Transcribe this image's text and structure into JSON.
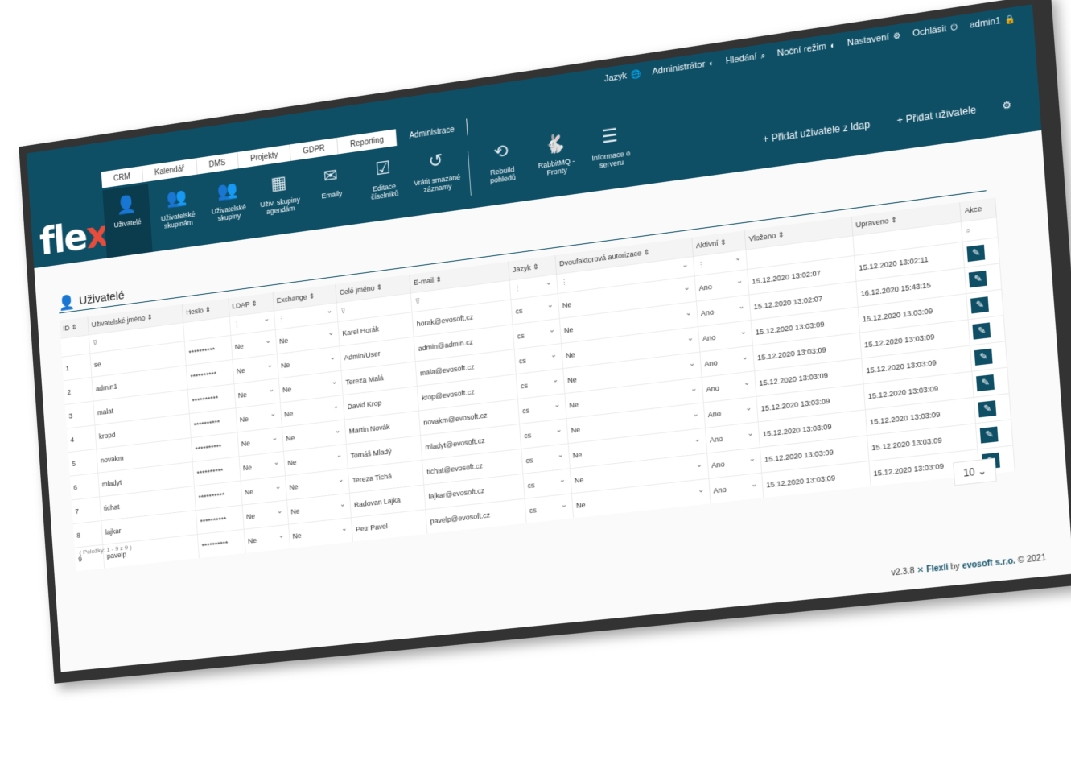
{
  "header": {
    "utility": [
      {
        "label": "Jazyk",
        "icon": "globe-icon"
      },
      {
        "label": "Administrátor",
        "icon": "toggle-icon"
      },
      {
        "label": "Hledání",
        "icon": "search-icon"
      },
      {
        "label": "Noční režim",
        "icon": "toggle-icon"
      },
      {
        "label": "Nastavení",
        "icon": "gear-icon"
      },
      {
        "label": "Ochlásit",
        "icon": "power-icon"
      },
      {
        "label": "admin1",
        "icon": "user-lock-icon"
      }
    ],
    "logo": "flexii",
    "tabs": [
      "CRM",
      "Kalendář",
      "DMS",
      "Projekty",
      "GDPR",
      "Reporting",
      "Administrace"
    ],
    "active_tab": "Administrace",
    "subnav": [
      {
        "label": "Uživatelé",
        "icon": "user-gear-icon",
        "active": true
      },
      {
        "label": "Uživatelské skupinám",
        "icon": "users-gear-icon"
      },
      {
        "label": "Uživatelské skupiny",
        "icon": "users-icon"
      },
      {
        "label": "Uživ. skupiny agendám",
        "icon": "group-board-icon"
      },
      {
        "label": "Emaily",
        "icon": "envelope-icon"
      },
      {
        "label": "Editace číselníků",
        "icon": "checklist-icon"
      },
      {
        "label": "Vrátit smazané záznamy",
        "icon": "history-icon"
      },
      {
        "label": "Rebuild pohledů",
        "icon": "rebuild-icon"
      },
      {
        "label": "RabbitMQ - Fronty",
        "icon": "rabbit-icon"
      },
      {
        "label": "Informace o serveru",
        "icon": "server-icon"
      }
    ],
    "buttons": {
      "add_ldap": "+ Přidat uživatele z ldap",
      "add_user": "+ Přidat uživatele",
      "settings_icon": "gear-icon"
    }
  },
  "page": {
    "title": "Uživatelé",
    "columns": [
      "ID",
      "Uživatelské jméno",
      "Heslo",
      "LDAP",
      "Exchange",
      "Celé jméno",
      "E-mail",
      "Jazyk",
      "Dvoufaktorová autorizace",
      "Aktivní",
      "Vloženo",
      "Upraveno",
      "Akce"
    ],
    "rows": [
      {
        "id": "1",
        "username": "se",
        "password": "**********",
        "ldap": "Ne",
        "exchange": "Ne",
        "name": "Karel Horák",
        "email": "horak@evosoft.cz",
        "lang": "cs",
        "twofa": "Ne",
        "active": "Ano",
        "created": "15.12.2020 13:02:07",
        "updated": "15.12.2020 13:02:11"
      },
      {
        "id": "2",
        "username": "admin1",
        "password": "**********",
        "ldap": "Ne",
        "exchange": "Ne",
        "name": "Admin/User",
        "email": "admin@admin.cz",
        "lang": "cs",
        "twofa": "Ne",
        "active": "Ano",
        "created": "15.12.2020 13:02:07",
        "updated": "16.12.2020 15:43:15"
      },
      {
        "id": "3",
        "username": "malat",
        "password": "**********",
        "ldap": "Ne",
        "exchange": "Ne",
        "name": "Tereza Malá",
        "email": "mala@evosoft.cz",
        "lang": "cs",
        "twofa": "Ne",
        "active": "Ano",
        "created": "15.12.2020 13:03:09",
        "updated": "15.12.2020 13:03:09"
      },
      {
        "id": "4",
        "username": "kropd",
        "password": "**********",
        "ldap": "Ne",
        "exchange": "Ne",
        "name": "David Krop",
        "email": "krop@evosoft.cz",
        "lang": "cs",
        "twofa": "Ne",
        "active": "Ano",
        "created": "15.12.2020 13:03:09",
        "updated": "15.12.2020 13:03:09"
      },
      {
        "id": "5",
        "username": "novakm",
        "password": "**********",
        "ldap": "Ne",
        "exchange": "Ne",
        "name": "Martin Novák",
        "email": "novakm@evosoft.cz",
        "lang": "cs",
        "twofa": "Ne",
        "active": "Ano",
        "created": "15.12.2020 13:03:09",
        "updated": "15.12.2020 13:03:09"
      },
      {
        "id": "6",
        "username": "mladyt",
        "password": "**********",
        "ldap": "Ne",
        "exchange": "Ne",
        "name": "Tomáš Mladý",
        "email": "mladyt@evosoft.cz",
        "lang": "cs",
        "twofa": "Ne",
        "active": "Ano",
        "created": "15.12.2020 13:03:09",
        "updated": "15.12.2020 13:03:09"
      },
      {
        "id": "7",
        "username": "tichat",
        "password": "**********",
        "ldap": "Ne",
        "exchange": "Ne",
        "name": "Tereza Tichá",
        "email": "tichat@evosoft.cz",
        "lang": "cs",
        "twofa": "Ne",
        "active": "Ano",
        "created": "15.12.2020 13:03:09",
        "updated": "15.12.2020 13:03:09"
      },
      {
        "id": "8",
        "username": "lajkar",
        "password": "**********",
        "ldap": "Ne",
        "exchange": "Ne",
        "name": "Radovan Lajka",
        "email": "lajkar@evosoft.cz",
        "lang": "cs",
        "twofa": "Ne",
        "active": "Ano",
        "created": "15.12.2020 13:03:09",
        "updated": "15.12.2020 13:03:09"
      },
      {
        "id": "9",
        "username": "pavelp",
        "password": "**********",
        "ldap": "Ne",
        "exchange": "Ne",
        "name": "Petr Pavel",
        "email": "pavelp@evosoft.cz",
        "lang": "cs",
        "twofa": "Ne",
        "active": "Ano",
        "created": "15.12.2020 13:03:09",
        "updated": "15.12.2020 13:03:09"
      }
    ],
    "pager_text": "( Položky: 1 - 9 z 9 )",
    "page_size": "10"
  },
  "footer": {
    "version": "v2.3.8",
    "brand": "Flexii",
    "by": "by",
    "company": "evosoft s.r.o.",
    "copyright": "© 2021"
  },
  "colors": {
    "primary": "#0e4f66",
    "accent": "#e74c3c"
  }
}
